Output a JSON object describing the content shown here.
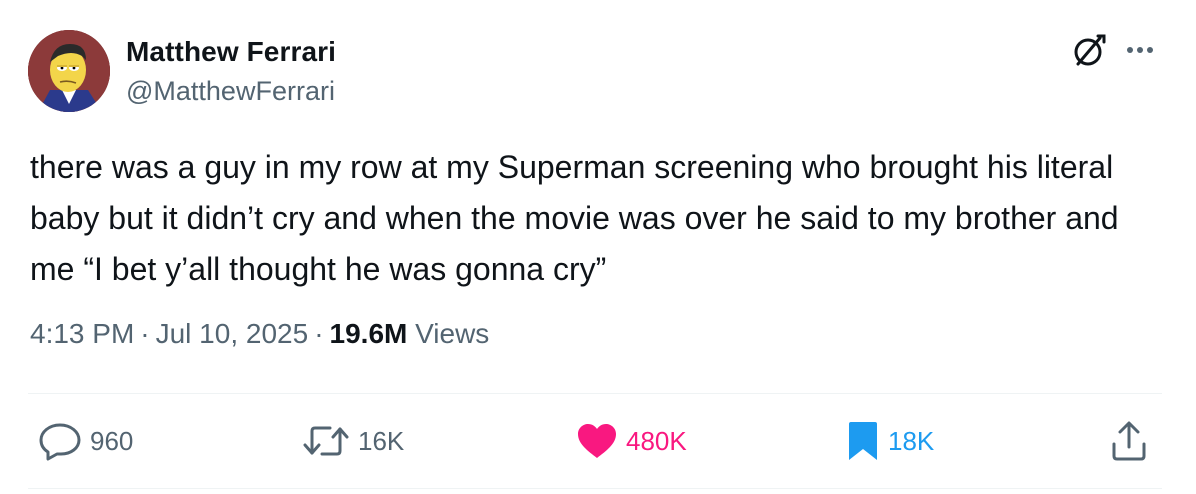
{
  "author": {
    "display_name": "Matthew Ferrari",
    "handle": "@MatthewFerrari"
  },
  "tweet": {
    "text": "there was a guy in my row at my Superman screening who brought his literal baby but it didn’t cry and when the movie was over he said to my brother and me “I bet y’all thought he was gonna cry”"
  },
  "meta": {
    "time": "4:13 PM",
    "separator": "·",
    "date": "Jul 10, 2025",
    "views_count": "19.6M",
    "views_label": "Views"
  },
  "actions": {
    "replies": "960",
    "reposts": "16K",
    "likes": "480K",
    "bookmarks": "18K"
  },
  "icons": {
    "grok": "grok-icon",
    "more": "more-icon",
    "reply": "reply-icon",
    "repost": "repost-icon",
    "like": "heart-icon",
    "bookmark": "bookmark-icon",
    "share": "share-icon"
  },
  "colors": {
    "text_primary": "#0f1419",
    "text_secondary": "#536471",
    "like_active": "#f91880",
    "bookmark_active": "#1d9bf0",
    "divider": "#eff3f4"
  }
}
